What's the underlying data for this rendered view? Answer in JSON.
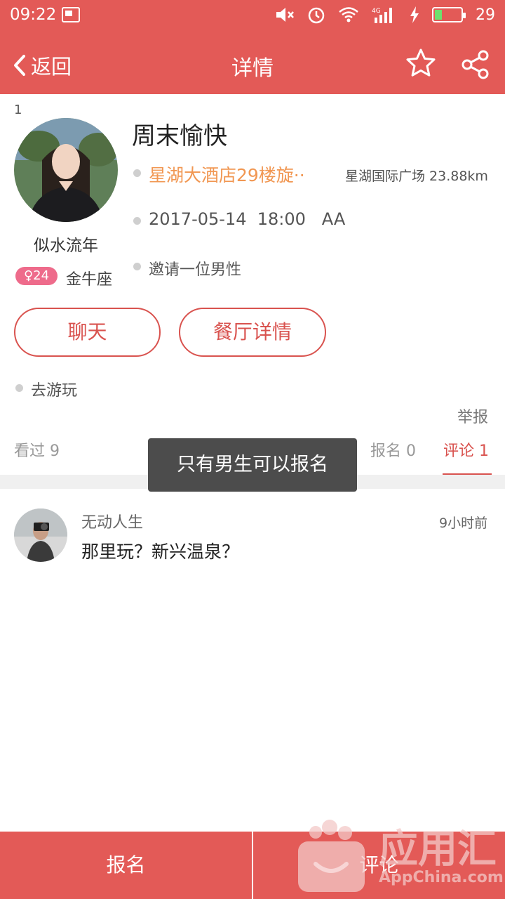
{
  "status_bar": {
    "time": "09:22",
    "battery_level": "29",
    "icons": [
      "image-icon",
      "mute-icon",
      "alarm-icon",
      "wifi-icon",
      "signal-4g-icon",
      "charging-icon",
      "battery-icon"
    ]
  },
  "nav": {
    "back_label": "返回",
    "title": "详情",
    "icons": [
      "chevron-left-icon",
      "star-icon",
      "share-icon"
    ]
  },
  "colors": {
    "brand_red": "#e35a57",
    "accent_red": "#d9534f",
    "location_orange": "#f19752",
    "badge_pink": "#ee6b8b"
  },
  "profile": {
    "index": "1",
    "name": "似水流年",
    "age_badge": "♀24",
    "zodiac": "金牛座"
  },
  "event": {
    "title": "周末愉快",
    "location": "星湖大酒店29楼旋··",
    "location_distance": "星湖国际广场 23.88km",
    "datetime": "2017-05-14  18:00   AA",
    "invite": "邀请一位男性"
  },
  "actions": {
    "chat": "聊天",
    "restaurant": "餐厅详情"
  },
  "description": "去游玩",
  "report": "举报",
  "tabs": {
    "viewed": "看过 9",
    "signup": "报名 0",
    "comment": "评论 1",
    "active": "comment"
  },
  "toast": "只有男生可以报名",
  "comments": [
    {
      "user": "无动人生",
      "time": "9小时前",
      "text": "那里玩？新兴温泉？"
    }
  ],
  "bottom_bar": {
    "signup": "报名",
    "comment": "评论"
  },
  "watermark": {
    "brand": "应用汇",
    "site": "AppChina.com"
  }
}
